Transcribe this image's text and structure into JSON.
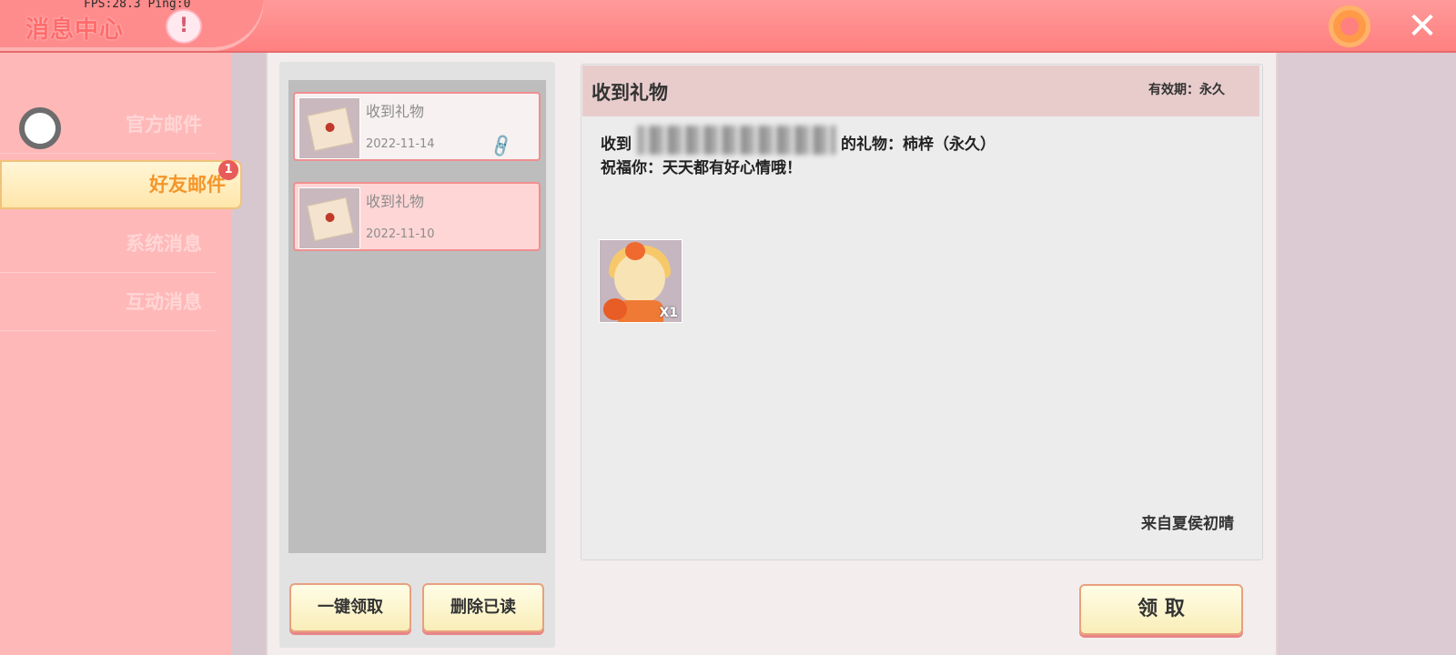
{
  "header": {
    "title": "消息中心",
    "fps_text": "FPS:28.3  Ping:0",
    "alert_symbol": "!",
    "close_symbol": "✕"
  },
  "sidebar": {
    "items": [
      {
        "label": "官方邮件"
      },
      {
        "label": "好友邮件",
        "badge": "1"
      },
      {
        "label": "系统消息"
      },
      {
        "label": "互动消息"
      }
    ]
  },
  "mail_list": {
    "items": [
      {
        "title": "收到礼物",
        "date": "2022-11-14",
        "has_attachment": true
      },
      {
        "title": "收到礼物",
        "date": "2022-11-10",
        "has_attachment": false
      }
    ],
    "claim_all_label": "一键领取",
    "delete_read_label": "删除已读"
  },
  "detail": {
    "title": "收到礼物",
    "validity": "有效期：永久",
    "line1_prefix": "收到",
    "line1_suffix": "的礼物：柿梓（永久）",
    "line2": "祝福你：天天都有好心情哦！",
    "gift_qty": "X1",
    "from": "来自夏侯初晴",
    "claim_label": "领 取"
  },
  "colors": {
    "topbar": "#ff8080",
    "sidebar": "#ffb8b8",
    "active_tab_text": "#f4952a",
    "button_fill": "#fdf6cf"
  }
}
